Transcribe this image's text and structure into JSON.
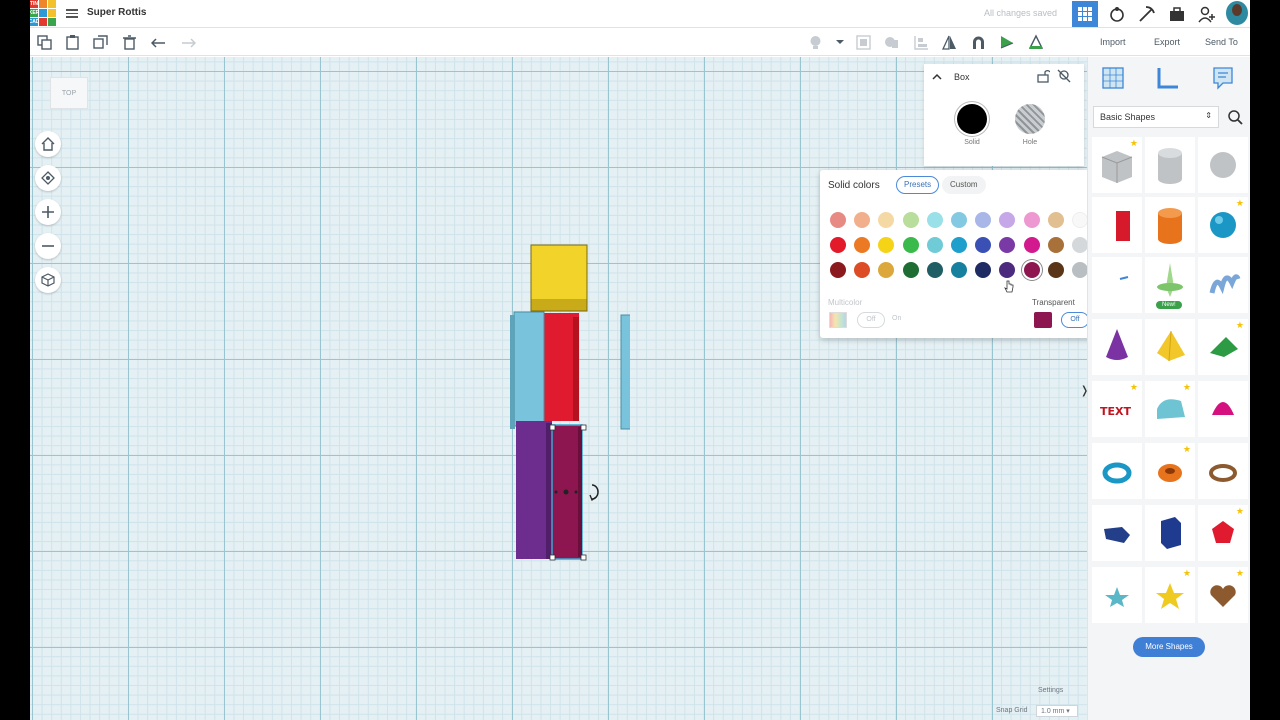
{
  "header": {
    "project_title": "Super Rottis",
    "save_status": "All changes saved",
    "logo_letters": [
      "TIN",
      "KER",
      "CAD"
    ]
  },
  "toolbar": {
    "import_label": "Import",
    "export_label": "Export",
    "send_to_label": "Send To"
  },
  "workplane": {
    "view_label": "TOP",
    "settings_label": "Settings",
    "snap_grid_label": "Snap Grid",
    "snap_grid_value": "1.0 mm"
  },
  "inspector": {
    "shape_name": "Box",
    "solid_label": "Solid",
    "hole_label": "Hole"
  },
  "color_picker": {
    "title": "Solid colors",
    "tab_presets": "Presets",
    "tab_custom": "Custom",
    "multicolor_label": "Multicolor",
    "transparent_label": "Transparent",
    "off_label": "Off",
    "on_label": "On",
    "selected_color": "#8d1550",
    "rows": [
      [
        "#e88a84",
        "#f1b08b",
        "#f5d9a4",
        "#b9dd9a",
        "#9ae0e8",
        "#84c9e2",
        "#a8b6e8",
        "#c6a7e8",
        "#ee98d1",
        "#e2bf90",
        "#f8f8f8",
        "#9a9c9e"
      ],
      [
        "#e21a2a",
        "#ec7a24",
        "#f5d418",
        "#3aba4a",
        "#6fcbd5",
        "#1f9fcc",
        "#3b50b4",
        "#7a3aa6",
        "#d2198d",
        "#a9713a",
        "#d5d8db",
        "#5a5d60"
      ],
      [
        "#8a1a1e",
        "#dc4d26",
        "#dca83c",
        "#1e6e33",
        "#1f5e65",
        "#18809f",
        "#1f2b63",
        "#4c2a7d",
        "#8d1550",
        "#5a3517",
        "#b9bec2",
        "#2b2b2b"
      ]
    ]
  },
  "library": {
    "category": "Basic Shapes",
    "new_badge": "New!",
    "more_shapes_label": "More Shapes"
  },
  "colors": {
    "accent": "#3d86d8",
    "grid_bg": "#e4f0f3",
    "yellow": "#f2d32a",
    "red": "#e01b2f",
    "light_blue": "#79c3dc",
    "purple": "#6d2d8f",
    "maroon": "#8d1550"
  }
}
